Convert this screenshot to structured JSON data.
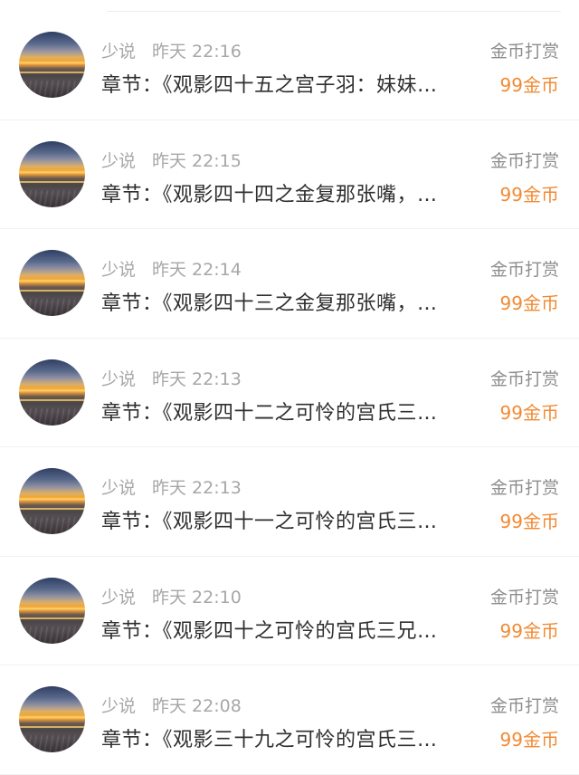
{
  "records": [
    {
      "user": "少说",
      "time": "昨天 22:16",
      "chapter": "章节：《观影四十五之宫子羽：妹妹…",
      "reward_label": "金币打赏",
      "amount": "99金币"
    },
    {
      "user": "少说",
      "time": "昨天 22:15",
      "chapter": "章节：《观影四十四之金复那张嘴，…",
      "reward_label": "金币打赏",
      "amount": "99金币"
    },
    {
      "user": "少说",
      "time": "昨天 22:14",
      "chapter": "章节：《观影四十三之金复那张嘴，…",
      "reward_label": "金币打赏",
      "amount": "99金币"
    },
    {
      "user": "少说",
      "time": "昨天 22:13",
      "chapter": "章节：《观影四十二之可怜的宫氏三…",
      "reward_label": "金币打赏",
      "amount": "99金币"
    },
    {
      "user": "少说",
      "time": "昨天 22:13",
      "chapter": "章节：《观影四十一之可怜的宫氏三…",
      "reward_label": "金币打赏",
      "amount": "99金币"
    },
    {
      "user": "少说",
      "time": "昨天 22:10",
      "chapter": "章节：《观影四十之可怜的宫氏三兄…",
      "reward_label": "金币打赏",
      "amount": "99金币"
    },
    {
      "user": "少说",
      "time": "昨天 22:08",
      "chapter": "章节：《观影三十九之可怜的宫氏三…",
      "reward_label": "金币打赏",
      "amount": "99金币"
    }
  ],
  "colors": {
    "meta_text": "#a7a7a7",
    "chapter_text": "#2f2f2f",
    "reward_label": "#8e8e8e",
    "amount": "#f28a33",
    "divider": "#f1f1f1"
  },
  "icons": {
    "avatar": "sunset-landscape-avatar"
  }
}
